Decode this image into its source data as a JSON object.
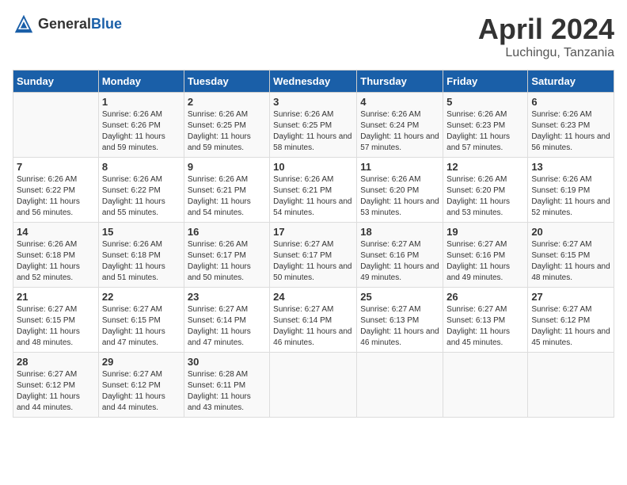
{
  "header": {
    "logo_general": "General",
    "logo_blue": "Blue",
    "month_year": "April 2024",
    "location": "Luchingu, Tanzania"
  },
  "calendar": {
    "days_of_week": [
      "Sunday",
      "Monday",
      "Tuesday",
      "Wednesday",
      "Thursday",
      "Friday",
      "Saturday"
    ],
    "weeks": [
      [
        {
          "day": "",
          "sunrise": "",
          "sunset": "",
          "daylight": ""
        },
        {
          "day": "1",
          "sunrise": "Sunrise: 6:26 AM",
          "sunset": "Sunset: 6:26 PM",
          "daylight": "Daylight: 11 hours and 59 minutes."
        },
        {
          "day": "2",
          "sunrise": "Sunrise: 6:26 AM",
          "sunset": "Sunset: 6:25 PM",
          "daylight": "Daylight: 11 hours and 59 minutes."
        },
        {
          "day": "3",
          "sunrise": "Sunrise: 6:26 AM",
          "sunset": "Sunset: 6:25 PM",
          "daylight": "Daylight: 11 hours and 58 minutes."
        },
        {
          "day": "4",
          "sunrise": "Sunrise: 6:26 AM",
          "sunset": "Sunset: 6:24 PM",
          "daylight": "Daylight: 11 hours and 57 minutes."
        },
        {
          "day": "5",
          "sunrise": "Sunrise: 6:26 AM",
          "sunset": "Sunset: 6:23 PM",
          "daylight": "Daylight: 11 hours and 57 minutes."
        },
        {
          "day": "6",
          "sunrise": "Sunrise: 6:26 AM",
          "sunset": "Sunset: 6:23 PM",
          "daylight": "Daylight: 11 hours and 56 minutes."
        }
      ],
      [
        {
          "day": "7",
          "sunrise": "Sunrise: 6:26 AM",
          "sunset": "Sunset: 6:22 PM",
          "daylight": "Daylight: 11 hours and 56 minutes."
        },
        {
          "day": "8",
          "sunrise": "Sunrise: 6:26 AM",
          "sunset": "Sunset: 6:22 PM",
          "daylight": "Daylight: 11 hours and 55 minutes."
        },
        {
          "day": "9",
          "sunrise": "Sunrise: 6:26 AM",
          "sunset": "Sunset: 6:21 PM",
          "daylight": "Daylight: 11 hours and 54 minutes."
        },
        {
          "day": "10",
          "sunrise": "Sunrise: 6:26 AM",
          "sunset": "Sunset: 6:21 PM",
          "daylight": "Daylight: 11 hours and 54 minutes."
        },
        {
          "day": "11",
          "sunrise": "Sunrise: 6:26 AM",
          "sunset": "Sunset: 6:20 PM",
          "daylight": "Daylight: 11 hours and 53 minutes."
        },
        {
          "day": "12",
          "sunrise": "Sunrise: 6:26 AM",
          "sunset": "Sunset: 6:20 PM",
          "daylight": "Daylight: 11 hours and 53 minutes."
        },
        {
          "day": "13",
          "sunrise": "Sunrise: 6:26 AM",
          "sunset": "Sunset: 6:19 PM",
          "daylight": "Daylight: 11 hours and 52 minutes."
        }
      ],
      [
        {
          "day": "14",
          "sunrise": "Sunrise: 6:26 AM",
          "sunset": "Sunset: 6:18 PM",
          "daylight": "Daylight: 11 hours and 52 minutes."
        },
        {
          "day": "15",
          "sunrise": "Sunrise: 6:26 AM",
          "sunset": "Sunset: 6:18 PM",
          "daylight": "Daylight: 11 hours and 51 minutes."
        },
        {
          "day": "16",
          "sunrise": "Sunrise: 6:26 AM",
          "sunset": "Sunset: 6:17 PM",
          "daylight": "Daylight: 11 hours and 50 minutes."
        },
        {
          "day": "17",
          "sunrise": "Sunrise: 6:27 AM",
          "sunset": "Sunset: 6:17 PM",
          "daylight": "Daylight: 11 hours and 50 minutes."
        },
        {
          "day": "18",
          "sunrise": "Sunrise: 6:27 AM",
          "sunset": "Sunset: 6:16 PM",
          "daylight": "Daylight: 11 hours and 49 minutes."
        },
        {
          "day": "19",
          "sunrise": "Sunrise: 6:27 AM",
          "sunset": "Sunset: 6:16 PM",
          "daylight": "Daylight: 11 hours and 49 minutes."
        },
        {
          "day": "20",
          "sunrise": "Sunrise: 6:27 AM",
          "sunset": "Sunset: 6:15 PM",
          "daylight": "Daylight: 11 hours and 48 minutes."
        }
      ],
      [
        {
          "day": "21",
          "sunrise": "Sunrise: 6:27 AM",
          "sunset": "Sunset: 6:15 PM",
          "daylight": "Daylight: 11 hours and 48 minutes."
        },
        {
          "day": "22",
          "sunrise": "Sunrise: 6:27 AM",
          "sunset": "Sunset: 6:15 PM",
          "daylight": "Daylight: 11 hours and 47 minutes."
        },
        {
          "day": "23",
          "sunrise": "Sunrise: 6:27 AM",
          "sunset": "Sunset: 6:14 PM",
          "daylight": "Daylight: 11 hours and 47 minutes."
        },
        {
          "day": "24",
          "sunrise": "Sunrise: 6:27 AM",
          "sunset": "Sunset: 6:14 PM",
          "daylight": "Daylight: 11 hours and 46 minutes."
        },
        {
          "day": "25",
          "sunrise": "Sunrise: 6:27 AM",
          "sunset": "Sunset: 6:13 PM",
          "daylight": "Daylight: 11 hours and 46 minutes."
        },
        {
          "day": "26",
          "sunrise": "Sunrise: 6:27 AM",
          "sunset": "Sunset: 6:13 PM",
          "daylight": "Daylight: 11 hours and 45 minutes."
        },
        {
          "day": "27",
          "sunrise": "Sunrise: 6:27 AM",
          "sunset": "Sunset: 6:12 PM",
          "daylight": "Daylight: 11 hours and 45 minutes."
        }
      ],
      [
        {
          "day": "28",
          "sunrise": "Sunrise: 6:27 AM",
          "sunset": "Sunset: 6:12 PM",
          "daylight": "Daylight: 11 hours and 44 minutes."
        },
        {
          "day": "29",
          "sunrise": "Sunrise: 6:27 AM",
          "sunset": "Sunset: 6:12 PM",
          "daylight": "Daylight: 11 hours and 44 minutes."
        },
        {
          "day": "30",
          "sunrise": "Sunrise: 6:28 AM",
          "sunset": "Sunset: 6:11 PM",
          "daylight": "Daylight: 11 hours and 43 minutes."
        },
        {
          "day": "",
          "sunrise": "",
          "sunset": "",
          "daylight": ""
        },
        {
          "day": "",
          "sunrise": "",
          "sunset": "",
          "daylight": ""
        },
        {
          "day": "",
          "sunrise": "",
          "sunset": "",
          "daylight": ""
        },
        {
          "day": "",
          "sunrise": "",
          "sunset": "",
          "daylight": ""
        }
      ]
    ]
  }
}
